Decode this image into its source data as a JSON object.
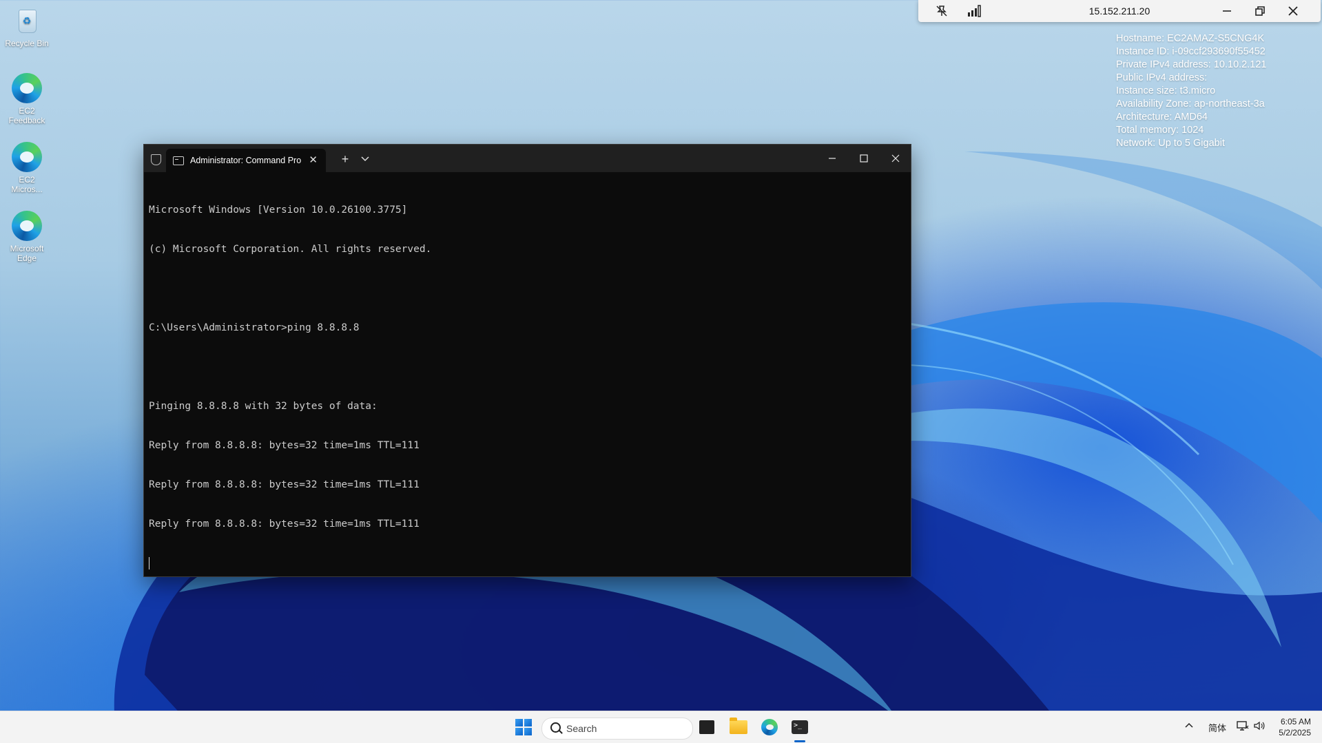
{
  "desktop": {
    "icons": [
      {
        "label": "Recycle Bin",
        "icon": "recycle-bin-icon"
      },
      {
        "label": "EC2 Feedback",
        "icon": "edge-shortcut-icon"
      },
      {
        "label": "EC2 Micros...",
        "icon": "edge-shortcut-icon"
      },
      {
        "label": "Microsoft Edge",
        "icon": "edge-icon"
      }
    ]
  },
  "rdp_bar": {
    "ip": "15.152.211.20",
    "icons": [
      "pin-off-icon",
      "signal-icon",
      "minimize-icon",
      "restore-icon",
      "close-icon"
    ]
  },
  "instance_info": [
    "Hostname: EC2AMAZ-S5CNG4K",
    "Instance ID: i-09ccf293690f55452",
    "Private IPv4 address: 10.10.2.121",
    "Public IPv4 address:",
    "Instance size: t3.micro",
    "Availability Zone: ap-northeast-3a",
    "Architecture: AMD64",
    "Total memory: 1024",
    "Network: Up to 5 Gigabit"
  ],
  "terminal": {
    "tab_title": "Administrator: Command Pro",
    "new_tab": "+",
    "lines": [
      "Microsoft Windows [Version 10.0.26100.3775]",
      "(c) Microsoft Corporation. All rights reserved.",
      "",
      "C:\\Users\\Administrator>ping 8.8.8.8",
      "",
      "Pinging 8.8.8.8 with 32 bytes of data:",
      "Reply from 8.8.8.8: bytes=32 time=1ms TTL=111",
      "Reply from 8.8.8.8: bytes=32 time=1ms TTL=111",
      "Reply from 8.8.8.8: bytes=32 time=1ms TTL=111"
    ]
  },
  "taskbar": {
    "search_placeholder": "Search",
    "ime": "简体",
    "time": "6:05 AM",
    "date": "5/2/2025"
  }
}
